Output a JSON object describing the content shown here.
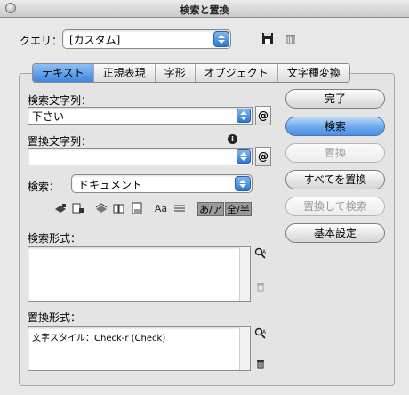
{
  "window": {
    "title": "検索と置換"
  },
  "query": {
    "label": "クエリ：",
    "value": "[カスタム]"
  },
  "icons": {
    "save": "floppy-disk-icon",
    "delete": "trash-icon"
  },
  "tabs": [
    {
      "label": "テキスト",
      "active": true
    },
    {
      "label": "正規表現"
    },
    {
      "label": "字形"
    },
    {
      "label": "オブジェクト"
    },
    {
      "label": "文字種変換"
    }
  ],
  "find": {
    "label": "検索文字列：",
    "value": "下さい",
    "special_char_button": "@"
  },
  "replace": {
    "label": "置換文字列：",
    "value": "",
    "special_char_button": "@",
    "info_icon": "i"
  },
  "search_scope": {
    "label": "検索：",
    "value": "ドキュメント"
  },
  "options": {
    "case_label": "Aa",
    "kana_label": "あ/ア",
    "width_label": "全/半"
  },
  "find_format": {
    "label": "検索形式：",
    "value": ""
  },
  "change_format": {
    "label": "置換形式：",
    "value": "文字スタイル：Check-r (Check)"
  },
  "buttons": {
    "done": "完了",
    "find": "検索",
    "change": "置換",
    "change_all": "すべてを置換",
    "change_find": "置換して検索",
    "fewer_options": "基本設定"
  }
}
